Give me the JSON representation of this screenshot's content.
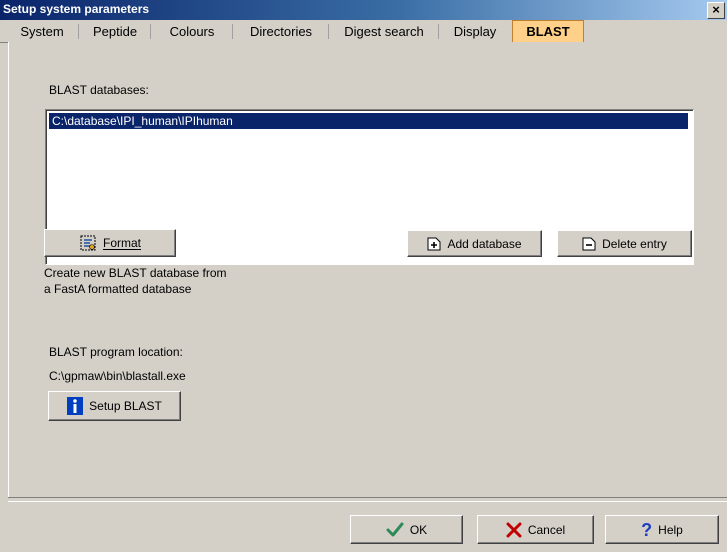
{
  "window": {
    "title": "Setup system parameters",
    "close_glyph": "×"
  },
  "tabs": [
    {
      "label": "System"
    },
    {
      "label": "Peptide"
    },
    {
      "label": "Colours"
    },
    {
      "label": "Directories"
    },
    {
      "label": "Digest search"
    },
    {
      "label": "Display"
    },
    {
      "label": "BLAST",
      "active": true
    }
  ],
  "blast": {
    "databases_label": "BLAST databases:",
    "databases": [
      "C:\\database\\IPI_human\\IPIhuman"
    ],
    "selected_index": 0,
    "format_button": "Format",
    "add_database_button": "Add database",
    "delete_entry_button": "Delete entry",
    "format_hint_line1": "Create new BLAST database from",
    "format_hint_line2": "a FastA formatted database",
    "program_location_label": "BLAST program location:",
    "program_location_value": "C:\\gpmaw\\bin\\blastall.exe",
    "setup_button": "Setup BLAST"
  },
  "footer": {
    "ok": "OK",
    "cancel": "Cancel",
    "help": "Help"
  },
  "colors": {
    "selection": "#0a246a",
    "active_tab": "#ffd08a",
    "ok_check": "#2e8b57",
    "cancel_x": "#c00000",
    "help_q": "#1f3fbf",
    "info_icon": "#0040c0"
  }
}
